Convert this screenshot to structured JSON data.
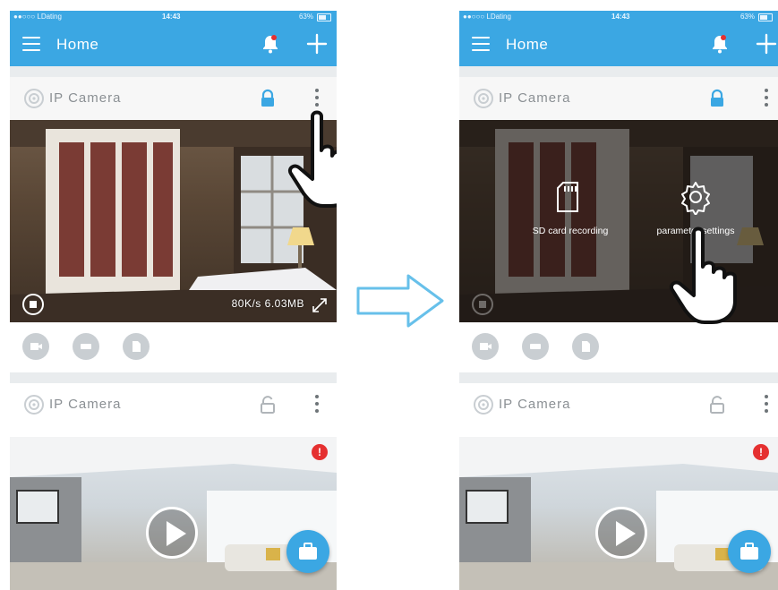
{
  "left": {
    "status": {
      "carrier": "●●○○○ LDating",
      "time": "14:43",
      "battery": "63%"
    },
    "appbar": {
      "title": "Home"
    },
    "camera1": {
      "name": "IP Camera",
      "stats": "80K/s 6.03MB"
    },
    "camera2": {
      "name": "IP Camera",
      "alert": "!"
    }
  },
  "right": {
    "status": {
      "carrier": "●●○○○ LDating",
      "time": "14:43",
      "battery": "63%"
    },
    "appbar": {
      "title": "Home"
    },
    "camera1": {
      "name": "IP Camera",
      "menu": {
        "sd_label": "SD card recording",
        "settings_label": "parameter settings"
      }
    },
    "camera2": {
      "name": "IP Camera",
      "alert": "!"
    }
  },
  "colors": {
    "accent": "#3ba7e3",
    "alert": "#e53030",
    "icon_grey": "#c9ced2",
    "text_grey": "#8b9094"
  },
  "icons": [
    "menu-icon",
    "bell-icon",
    "plus-icon",
    "camera-icon",
    "lock-icon",
    "unlock-icon",
    "more-icon",
    "stop-icon",
    "fullscreen-icon",
    "record-icon",
    "sd-card-icon",
    "gear-icon",
    "play-icon",
    "briefcase-icon",
    "arrow-right-icon",
    "hand-pointer-icon"
  ]
}
